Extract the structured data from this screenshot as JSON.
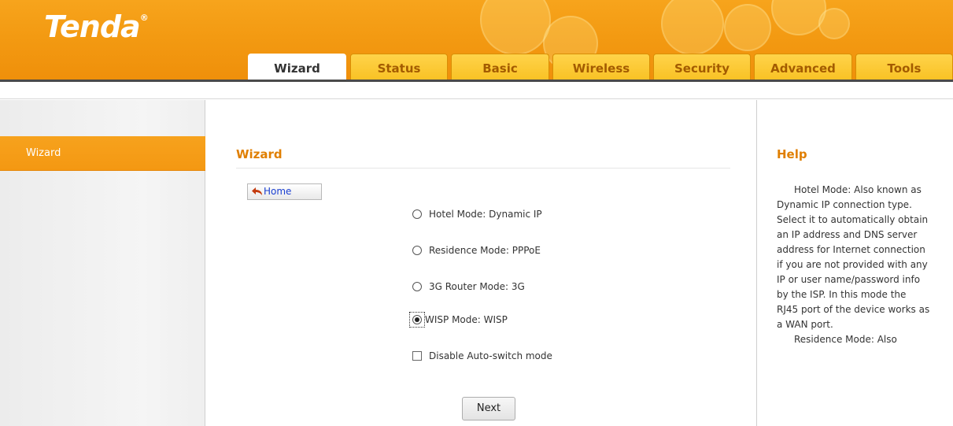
{
  "brand": {
    "logo_text": "Tenda",
    "registered_mark": "®",
    "accent_color": "#f39a12"
  },
  "tabs": [
    {
      "label": "Wizard",
      "active": true
    },
    {
      "label": "Status",
      "active": false
    },
    {
      "label": "Basic",
      "active": false
    },
    {
      "label": "Wireless",
      "active": false
    },
    {
      "label": "Security",
      "active": false
    },
    {
      "label": "Advanced",
      "active": false
    },
    {
      "label": "Tools",
      "active": false
    }
  ],
  "sidebar": {
    "items": [
      {
        "label": "Wizard",
        "active": true
      }
    ]
  },
  "main": {
    "title": "Wizard",
    "home_button": {
      "label": "Home",
      "icon": "home-arrow-icon"
    },
    "options": [
      {
        "label": "Hotel Mode: Dynamic IP",
        "checked": false
      },
      {
        "label": "Residence Mode: PPPoE",
        "checked": false
      },
      {
        "label": "3G Router Mode: 3G",
        "checked": false
      },
      {
        "label": "WISP Mode: WISP",
        "checked": true
      }
    ],
    "disable_auto_switch": {
      "label": "Disable Auto-switch mode",
      "checked": false
    },
    "next_button": "Next"
  },
  "help": {
    "title": "Help",
    "paragraph_1": "Hotel Mode: Also known as Dynamic IP connection type. Select it to automatically obtain an IP address and DNS server address for Internet connection if you are not provided with any IP or user name/password info by the ISP. In this mode the RJ45 port of the device works as a WAN port.",
    "paragraph_2": "Residence Mode: Also"
  }
}
